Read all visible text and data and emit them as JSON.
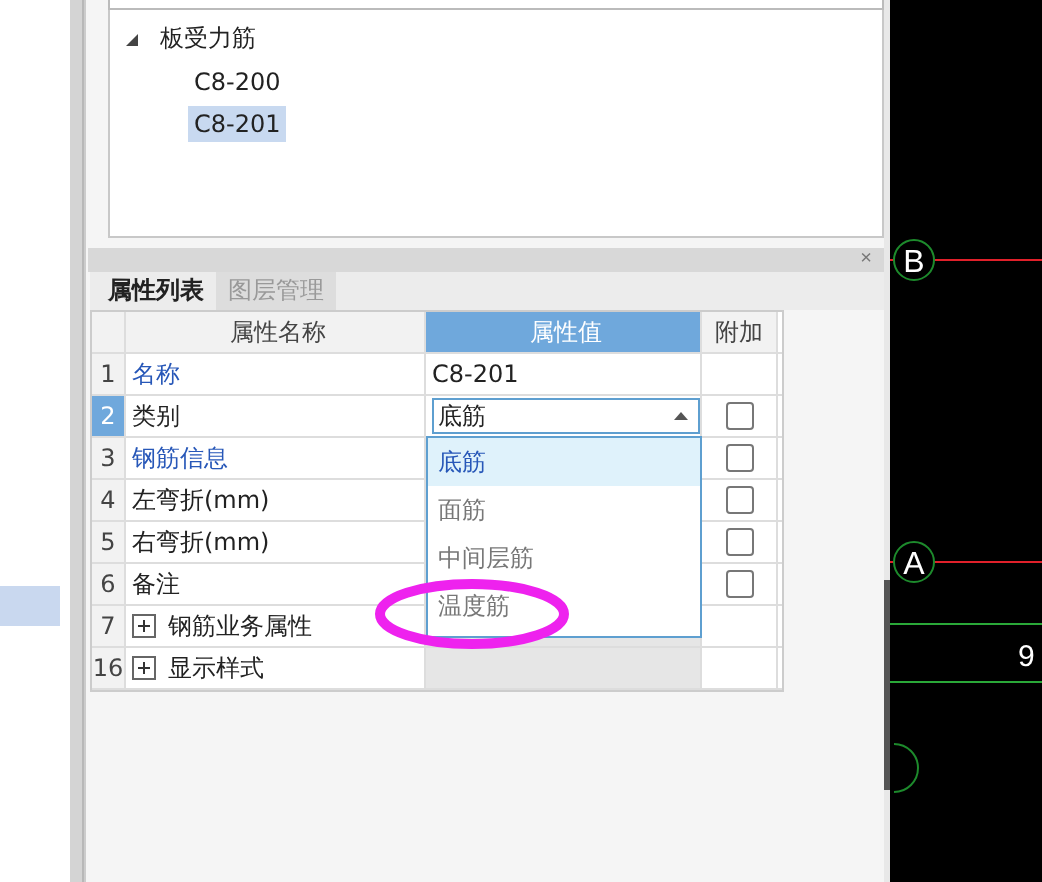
{
  "tree": {
    "root": {
      "label": "板受力筋",
      "expanded": true,
      "children": [
        {
          "label": "C8-200",
          "selected": false
        },
        {
          "label": "C8-201",
          "selected": true
        }
      ]
    }
  },
  "properties": {
    "close": "×",
    "tabs": [
      {
        "label": "属性列表",
        "selected": true
      },
      {
        "label": "图层管理",
        "selected": false
      }
    ],
    "columns": [
      "属性名称",
      "属性值",
      "附加"
    ],
    "rows": [
      {
        "index": "1",
        "name": "名称",
        "kind": "category",
        "value": "C8-201",
        "selected": false
      },
      {
        "index": "2",
        "name": "类别",
        "kind": "combo",
        "value": "底筋",
        "selected": true,
        "checked": false
      },
      {
        "index": "3",
        "name": "钢筋信息",
        "kind": "category",
        "selected": false,
        "checked": false
      },
      {
        "index": "4",
        "name": "左弯折(mm)",
        "kind": "plain",
        "selected": false,
        "checked": false
      },
      {
        "index": "5",
        "name": "右弯折(mm)",
        "kind": "plain",
        "selected": false,
        "checked": false
      },
      {
        "index": "6",
        "name": "备注",
        "kind": "plain",
        "selected": false,
        "checked": false
      },
      {
        "index": "7",
        "name": "钢筋业务属性",
        "kind": "group",
        "expanded": false,
        "selected": false
      },
      {
        "index": "16",
        "name": "显示样式",
        "kind": "group",
        "expanded": false,
        "selected": false
      }
    ],
    "dropdown": {
      "options": [
        {
          "label": "底筋",
          "selected": true
        },
        {
          "label": "面筋",
          "selected": false
        },
        {
          "label": "中间层筋",
          "selected": false
        },
        {
          "label": "温度筋",
          "selected": false
        }
      ]
    }
  },
  "canvas": {
    "axes": [
      {
        "label": "B"
      },
      {
        "label": "A"
      }
    ],
    "dimension": "9"
  }
}
